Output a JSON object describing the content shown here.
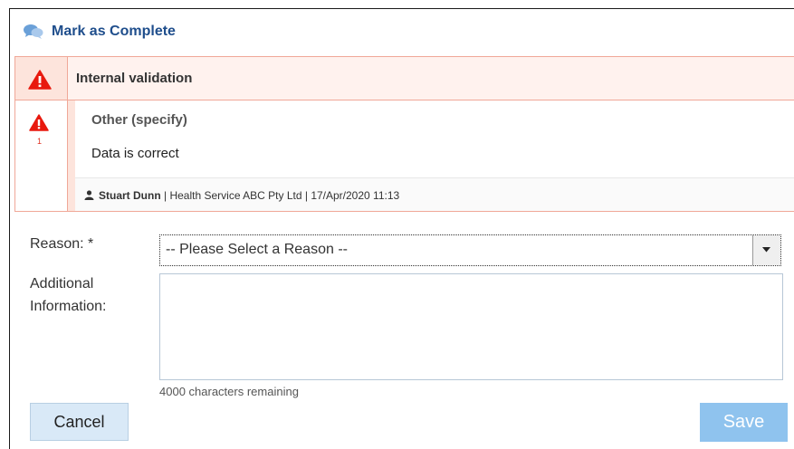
{
  "dialog": {
    "title": "Mark as Complete",
    "title_icon": "comments-icon"
  },
  "validation": {
    "group_title": "Internal validation",
    "group_icon": "warning-triangle-icon",
    "item": {
      "icon": "warning-triangle-icon",
      "count": "1",
      "type": "Other (specify)",
      "text": "Data is correct",
      "user_icon": "user-icon",
      "author": "Stuart Dunn",
      "organisation": " | Health Service ABC Pty Ltd | ",
      "timestamp": "17/Apr/2020 11:13"
    }
  },
  "form": {
    "reason_label": "Reason: *",
    "reason_selected": "-- Please Select a Reason --",
    "additional_label_line1": "Additional",
    "additional_label_line2": "Information:",
    "additional_value": "",
    "chars_remaining": "4000 characters remaining"
  },
  "buttons": {
    "cancel": "Cancel",
    "save": "Save"
  },
  "colors": {
    "title": "#1f4e8c",
    "warning": "#e8190e",
    "validation_border": "#f0a898",
    "save_bg": "#8fc3ee",
    "cancel_bg": "#d9e9f7"
  }
}
